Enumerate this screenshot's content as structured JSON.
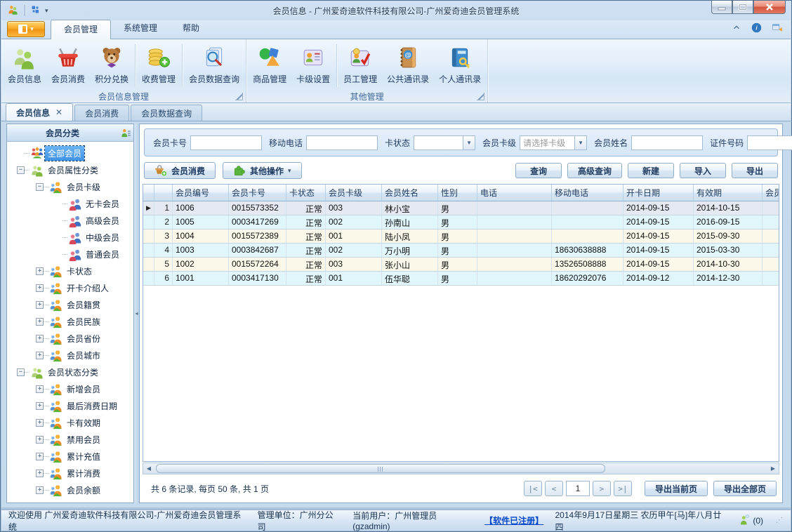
{
  "window": {
    "title": "会员信息 - 广州爱奇迪软件科技有限公司-广州爱奇迪会员管理系统",
    "controls": [
      {
        "name": "minimize-button",
        "glyph": "min"
      },
      {
        "name": "maximize-button",
        "glyph": "max"
      },
      {
        "name": "close-button",
        "glyph": "close"
      }
    ]
  },
  "quick_access": {
    "app_icon": "people-icon",
    "layout_icon": "grid-squares-icon",
    "caret": "▾"
  },
  "ribbon": {
    "tabs": [
      {
        "label": "会员管理",
        "active": true
      },
      {
        "label": "系统管理",
        "active": false
      },
      {
        "label": "帮助",
        "active": false
      }
    ],
    "strip_icons": [
      "collapse-ribbon-icon",
      "info-icon",
      "switch-window-icon"
    ],
    "groups": [
      {
        "name": "会员信息管理",
        "items": [
          {
            "label": "会员信息",
            "icon": "members"
          },
          {
            "label": "会员消费",
            "icon": "basket"
          },
          {
            "label": "积分兑换",
            "icon": "bear"
          },
          {
            "label": "收费管理",
            "icon": "coins",
            "sep_before": true
          },
          {
            "label": "会员数据查询",
            "icon": "docsearch",
            "sep_before": true
          }
        ]
      },
      {
        "name": "其他管理",
        "items": [
          {
            "label": "商品管理",
            "icon": "goods"
          },
          {
            "label": "卡级设置",
            "icon": "cardlevel"
          },
          {
            "label": "员工管理",
            "icon": "staff",
            "sep_before": true
          },
          {
            "label": "公共通讯录",
            "icon": "bookat"
          },
          {
            "label": "个人通讯录",
            "icon": "bookkey"
          }
        ]
      }
    ]
  },
  "doc_tabs": [
    {
      "label": "会员信息",
      "active": true,
      "closable": true
    },
    {
      "label": "会员消费",
      "active": false
    },
    {
      "label": "会员数据查询",
      "active": false
    }
  ],
  "sidebar": {
    "header": "会员分类",
    "tree": [
      {
        "label": "全部会员",
        "level": 0,
        "icon": "tgroup",
        "expander": "",
        "selected": true
      },
      {
        "label": "会员属性分类",
        "level": 0,
        "icon": "tgreen",
        "expander": "-"
      },
      {
        "label": "会员卡级",
        "level": 1,
        "icon": "torange",
        "expander": "-"
      },
      {
        "label": "无卡会员",
        "level": 2,
        "icon": "tpair",
        "expander": ""
      },
      {
        "label": "高级会员",
        "level": 2,
        "icon": "tpair",
        "expander": ""
      },
      {
        "label": "中级会员",
        "level": 2,
        "icon": "tpair",
        "expander": ""
      },
      {
        "label": "普通会员",
        "level": 2,
        "icon": "tpair",
        "expander": ""
      },
      {
        "label": "卡状态",
        "level": 1,
        "icon": "torange",
        "expander": "+"
      },
      {
        "label": "开卡介绍人",
        "level": 1,
        "icon": "torange",
        "expander": "+"
      },
      {
        "label": "会员籍贯",
        "level": 1,
        "icon": "torange",
        "expander": "+"
      },
      {
        "label": "会员民族",
        "level": 1,
        "icon": "torange",
        "expander": "+"
      },
      {
        "label": "会员省份",
        "level": 1,
        "icon": "torange",
        "expander": "+"
      },
      {
        "label": "会员城市",
        "level": 1,
        "icon": "torange",
        "expander": "+"
      },
      {
        "label": "会员状态分类",
        "level": 0,
        "icon": "tgreen",
        "expander": "-"
      },
      {
        "label": "新增会员",
        "level": 1,
        "icon": "torange",
        "expander": "+"
      },
      {
        "label": "最后消费日期",
        "level": 1,
        "icon": "torange",
        "expander": "+"
      },
      {
        "label": "卡有效期",
        "level": 1,
        "icon": "torange",
        "expander": "+"
      },
      {
        "label": "禁用会员",
        "level": 1,
        "icon": "torange",
        "expander": "+"
      },
      {
        "label": "累计充值",
        "level": 1,
        "icon": "torange",
        "expander": "+"
      },
      {
        "label": "累计消费",
        "level": 1,
        "icon": "torange",
        "expander": "+"
      },
      {
        "label": "会员余额",
        "level": 1,
        "icon": "torange",
        "expander": "+"
      }
    ]
  },
  "filters": [
    {
      "label": "会员卡号",
      "type": "input",
      "value": ""
    },
    {
      "label": "移动电话",
      "type": "input",
      "value": ""
    },
    {
      "label": "卡状态",
      "type": "select",
      "value": "",
      "width": 88
    },
    {
      "label": "会员卡级",
      "type": "select",
      "value": "请选择卡级",
      "placeholder": true,
      "width": 96
    },
    {
      "label": "会员姓名",
      "type": "input",
      "value": ""
    },
    {
      "label": "证件号码",
      "type": "input",
      "value": ""
    }
  ],
  "toolbar": {
    "left": [
      {
        "label": "会员消费",
        "icon": "basketplus"
      },
      {
        "label": "其他操作",
        "icon": "puzzle",
        "caret": "▾"
      }
    ],
    "right": [
      {
        "label": "查询"
      },
      {
        "label": "高级查询"
      },
      {
        "label": "新建"
      },
      {
        "label": "导入"
      },
      {
        "label": "导出"
      }
    ]
  },
  "grid": {
    "columns": [
      {
        "label": "",
        "w": 16
      },
      {
        "label": "",
        "w": 26
      },
      {
        "label": "会员编号",
        "w": 80
      },
      {
        "label": "会员卡号",
        "w": 82
      },
      {
        "label": "卡状态",
        "w": 56
      },
      {
        "label": "会员卡级",
        "w": 80
      },
      {
        "label": "会员姓名",
        "w": 80
      },
      {
        "label": "性别",
        "w": 56
      },
      {
        "label": "电话",
        "w": 106
      },
      {
        "label": "移动电话",
        "w": 102
      },
      {
        "label": "开卡日期",
        "w": 100
      },
      {
        "label": "有效期",
        "w": 98
      },
      {
        "label": "会员",
        "w": 24
      }
    ],
    "selected_row": 0,
    "rows": [
      [
        "1",
        "1006",
        "0015573352",
        "正常",
        "003",
        "林小宝",
        "男",
        "",
        "",
        "2014-09-15",
        "2014-10-15",
        ""
      ],
      [
        "2",
        "1005",
        "0003417269",
        "正常",
        "002",
        "孙南山",
        "男",
        "",
        "",
        "2014-09-15",
        "2016-09-15",
        ""
      ],
      [
        "3",
        "1004",
        "0015572389",
        "正常",
        "001",
        "陆小凤",
        "男",
        "",
        "",
        "2014-09-15",
        "2015-09-30",
        ""
      ],
      [
        "4",
        "1003",
        "0003842687",
        "正常",
        "002",
        "万小明",
        "男",
        "",
        "18630638888",
        "2014-09-15",
        "2015-03-30",
        ""
      ],
      [
        "5",
        "1002",
        "0015572264",
        "正常",
        "003",
        "张小山",
        "男",
        "",
        "13526508888",
        "2014-09-15",
        "2014-10-30",
        ""
      ],
      [
        "6",
        "1001",
        "0003417130",
        "正常",
        "001",
        "伍华聪",
        "男",
        "",
        "18620292076",
        "2014-09-12",
        "2014-12-30",
        ""
      ]
    ]
  },
  "pager": {
    "summary": "共 6 条记录, 每页 50 条, 共 1 页",
    "nav": [
      "|<",
      "<"
    ],
    "page_value": "1",
    "nav_after": [
      ">",
      ">|"
    ],
    "export_current": "导出当前页",
    "export_all": "导出全部页"
  },
  "statusbar": {
    "welcome": "欢迎使用 广州爱奇迪软件科技有限公司-广州爱奇迪会员管理系统",
    "org": "管理单位：广州分公司",
    "user": "当前用户：广州管理员(gzadmin)",
    "registered": "【软件已注册】",
    "date": "2014年9月17日星期三 农历甲午[马]年八月廿四",
    "message_count": "(0)"
  },
  "colors": {
    "accent_orange": "#f7a928",
    "row_cream": "#fbf7e9",
    "row_cyan": "#e0f6fa",
    "row_selected": "#e4e9f2",
    "tree_selected": "#3f92e6",
    "link_blue": "#0047c8"
  }
}
